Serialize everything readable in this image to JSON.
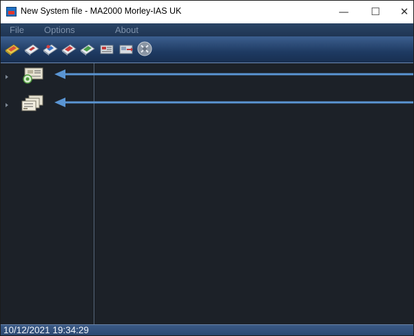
{
  "window": {
    "title": "New System file - MA2000 Morley-IAS UK",
    "minimize_glyph": "—",
    "maximize_glyph": "☐",
    "close_glyph": "✕"
  },
  "menu": {
    "items": [
      {
        "label": "File"
      },
      {
        "label": "Options"
      },
      {
        "label": "About"
      }
    ]
  },
  "toolbar": {
    "icons": [
      {
        "name": "open-file-icon"
      },
      {
        "name": "save-icon"
      },
      {
        "name": "save-as-icon"
      },
      {
        "name": "print-icon"
      },
      {
        "name": "upload-icon"
      },
      {
        "name": "panel-config-icon"
      },
      {
        "name": "panel-transfer-icon"
      },
      {
        "name": "tools-icon"
      }
    ]
  },
  "tree": {
    "nodes": [
      {
        "name": "tree-node-panel",
        "icon": "panel-device-icon"
      },
      {
        "name": "tree-node-loops",
        "icon": "loop-devices-icon"
      }
    ]
  },
  "annotation_color": "#5a95d3",
  "status": {
    "datetime": "10/12/2021 19:34:29"
  }
}
